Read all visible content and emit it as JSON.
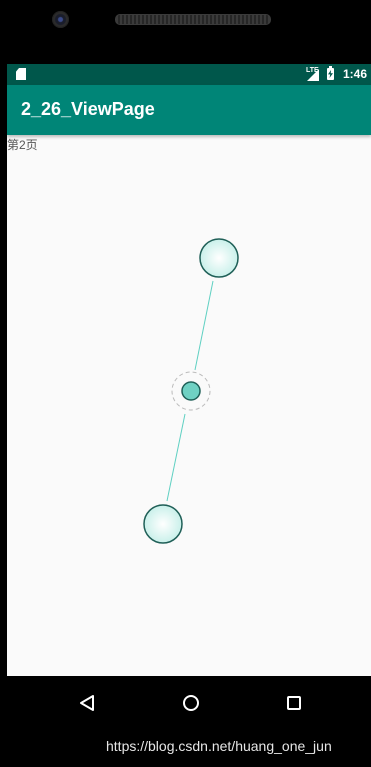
{
  "status_bar": {
    "time": "1:46",
    "network_label": "LTE",
    "sd_icon": "sd-card-icon",
    "signal_icon": "cell-signal-icon",
    "battery_icon": "battery-charging-icon",
    "background": "#00574b"
  },
  "app_bar": {
    "title": "2_26_ViewPage",
    "background": "#008577"
  },
  "content": {
    "page_label": "第2页",
    "accent": "#6fd1c3"
  },
  "navigation": {
    "back_icon": "back-triangle-icon",
    "home_icon": "home-circle-icon",
    "recents_icon": "recents-square-icon"
  },
  "watermark": "https://blog.csdn.net/huang_one_jun"
}
